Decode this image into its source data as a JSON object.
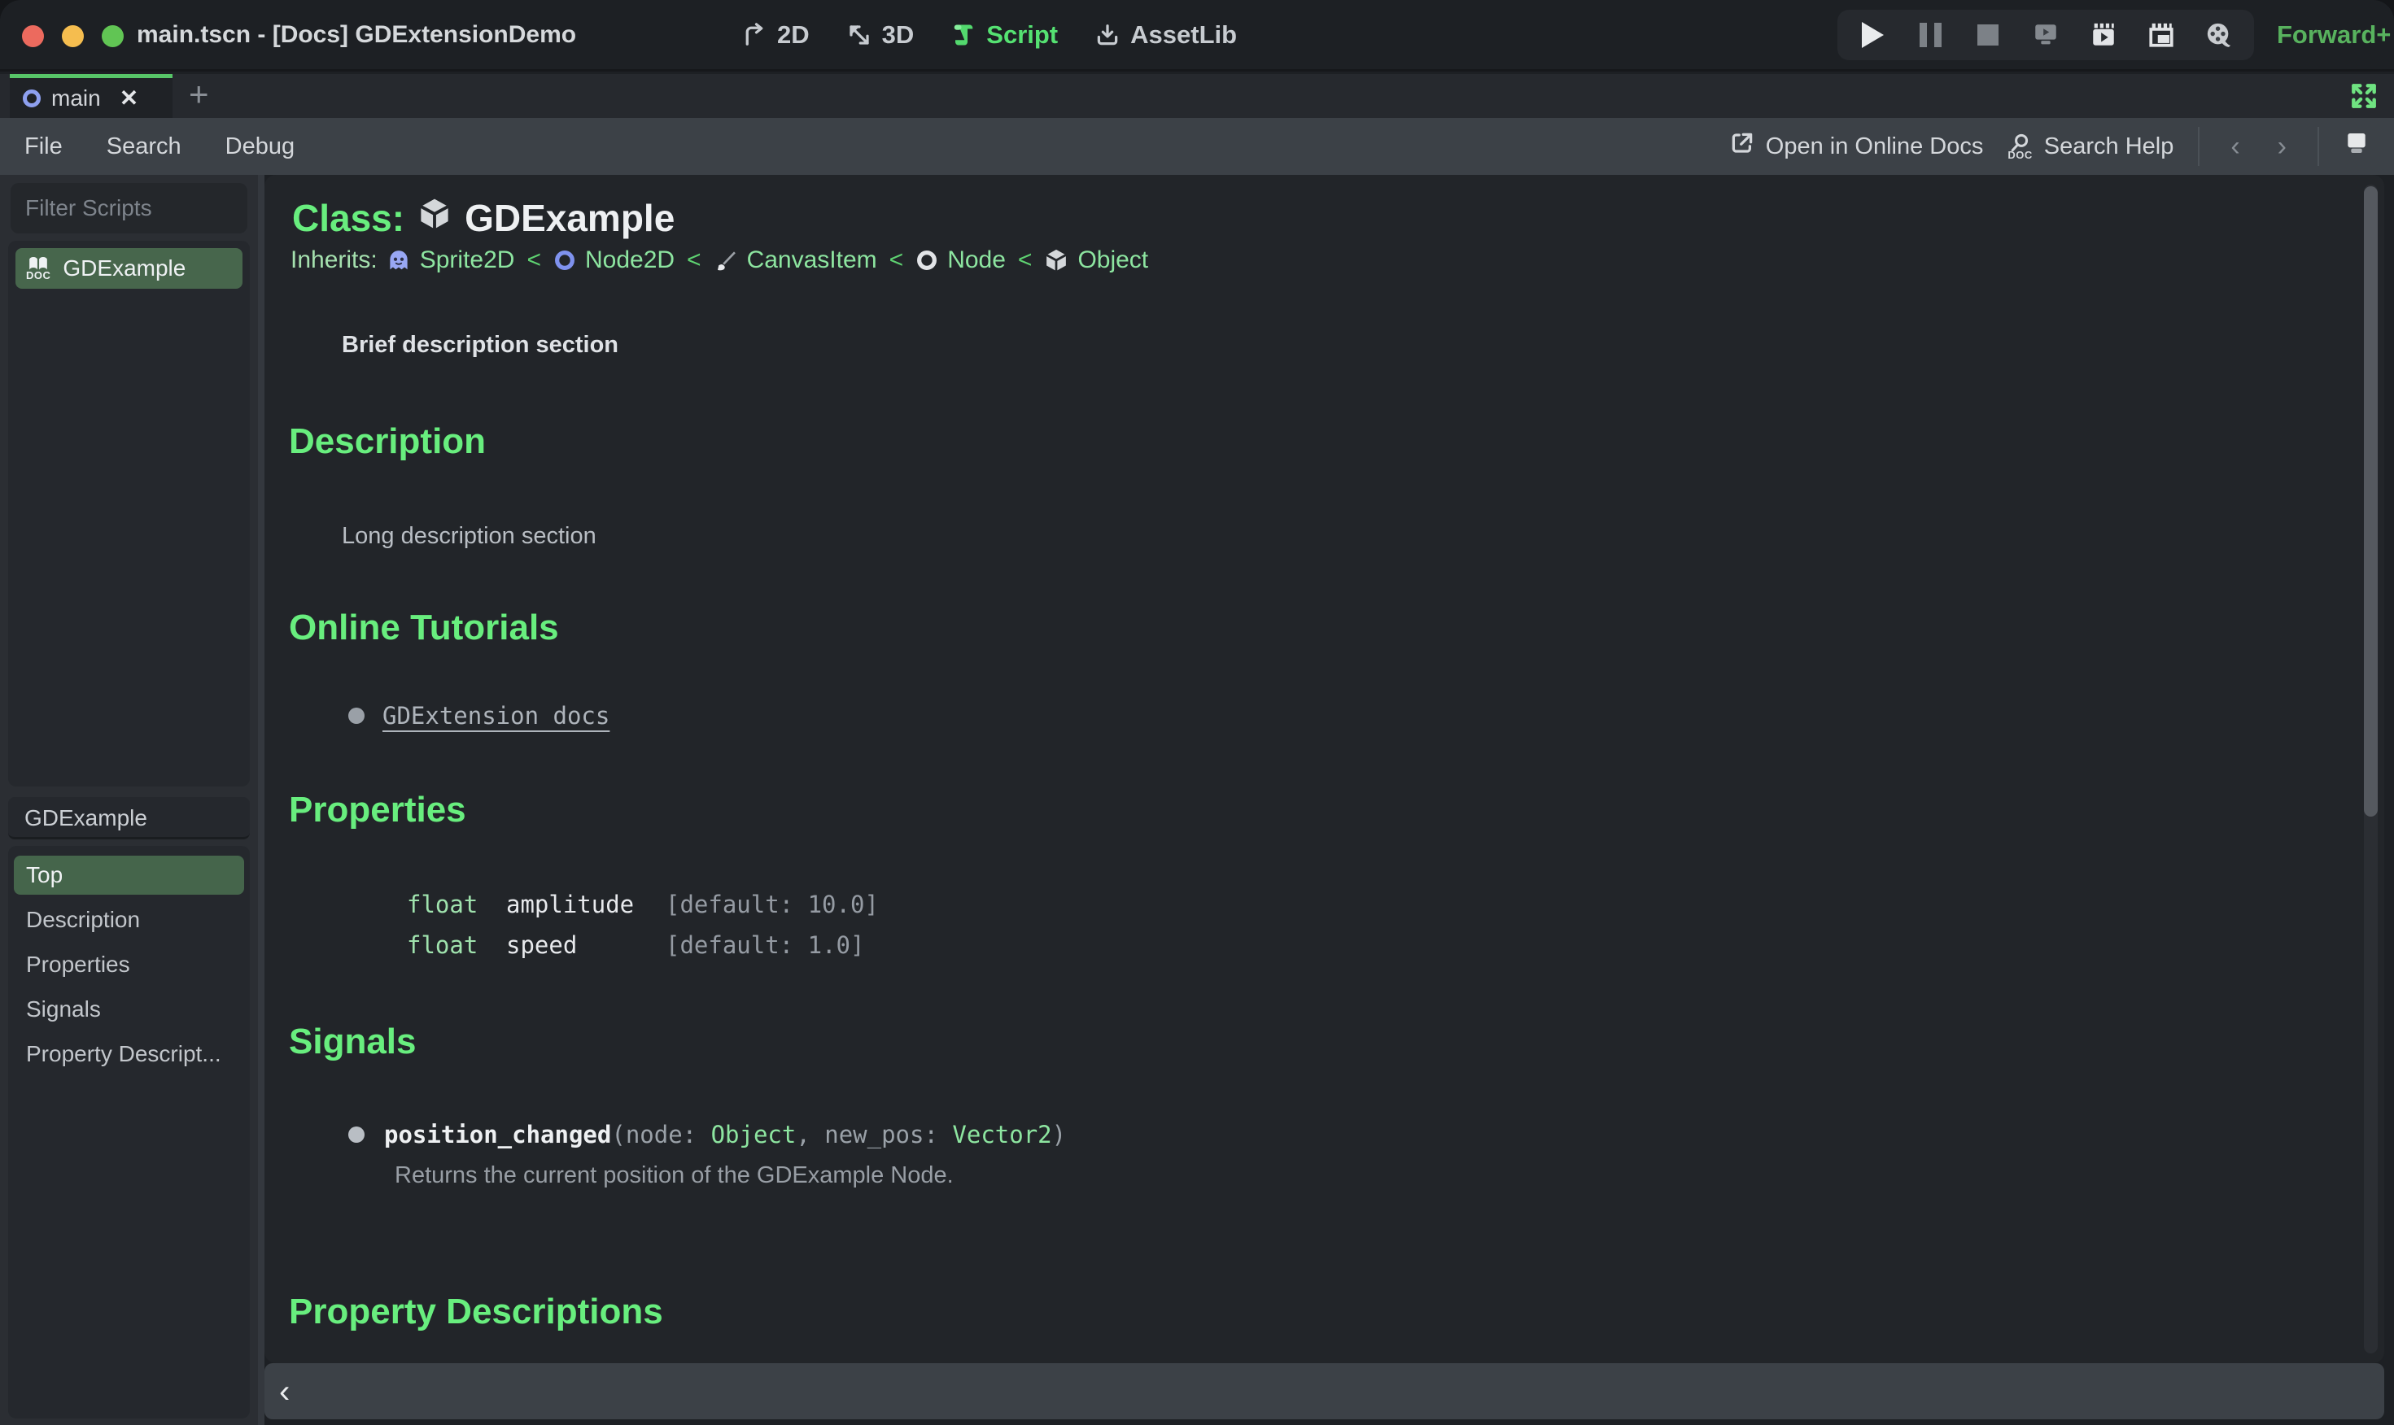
{
  "window": {
    "title": "main.tscn - [Docs] GDExtensionDemo"
  },
  "workspaces": {
    "items": [
      {
        "label": "2D",
        "active": false
      },
      {
        "label": "3D",
        "active": false
      },
      {
        "label": "Script",
        "active": true
      },
      {
        "label": "AssetLib",
        "active": false
      }
    ]
  },
  "playback": {
    "renderer_label": "Forward+"
  },
  "scene_tabs": {
    "items": [
      {
        "label": "main"
      }
    ]
  },
  "menus": {
    "items": [
      {
        "label": "File"
      },
      {
        "label": "Search"
      },
      {
        "label": "Debug"
      }
    ],
    "online_docs_label": "Open in Online Docs",
    "search_help_label": "Search Help"
  },
  "sidebar": {
    "filter_placeholder": "Filter Scripts",
    "scripts": [
      {
        "label": "GDExample",
        "selected": true
      }
    ],
    "member_header": "GDExample",
    "sections": [
      {
        "label": "Top",
        "selected": true
      },
      {
        "label": "Description",
        "selected": false
      },
      {
        "label": "Properties",
        "selected": false
      },
      {
        "label": "Signals",
        "selected": false
      },
      {
        "label": "Property Descript...",
        "selected": false
      }
    ]
  },
  "doc": {
    "class_label": "Class:",
    "class_name": "GDExample",
    "inherits_label": "Inherits:",
    "separator": "<",
    "inherits_chain": [
      {
        "name": "Sprite2D"
      },
      {
        "name": "Node2D"
      },
      {
        "name": "CanvasItem"
      },
      {
        "name": "Node"
      },
      {
        "name": "Object"
      }
    ],
    "brief": "Brief description section",
    "description": {
      "heading": "Description",
      "body": "Long description section"
    },
    "tutorials": {
      "heading": "Online Tutorials",
      "links": [
        {
          "label": "GDExtension docs"
        }
      ]
    },
    "properties": {
      "heading": "Properties",
      "rows": [
        {
          "type": "float",
          "name": "amplitude",
          "default": "[default: 10.0]"
        },
        {
          "type": "float",
          "name": "speed",
          "default": "[default: 1.0]"
        }
      ]
    },
    "signals": {
      "heading": "Signals",
      "items": [
        {
          "name": "position_changed",
          "sig_open": "(node: ",
          "type1": "Object",
          "sig_mid": ", new_pos: ",
          "type2": "Vector2",
          "sig_close": ")",
          "description": "Returns the current position of the GDExample Node."
        }
      ]
    },
    "property_descriptions": {
      "heading": "Property Descriptions"
    }
  },
  "icons": {
    "close": "✕",
    "plus": "+",
    "back": "‹",
    "forward": "›",
    "collapse": "‹",
    "doc_text": "DOC"
  },
  "colors": {
    "heading_green": "#68ee7e",
    "link_green": "#8de5a0",
    "selected_green_bg": "#47664c",
    "tab_accent_green": "#57c568",
    "renderer_green": "#58b25e",
    "workspace_active_green": "#55e272",
    "main_bg": "#222529",
    "sidebar_bg": "#2b2e33",
    "panel_bg": "#25282d",
    "menubar_bg": "#3c4147",
    "titlebar_bg": "#1d2024"
  }
}
